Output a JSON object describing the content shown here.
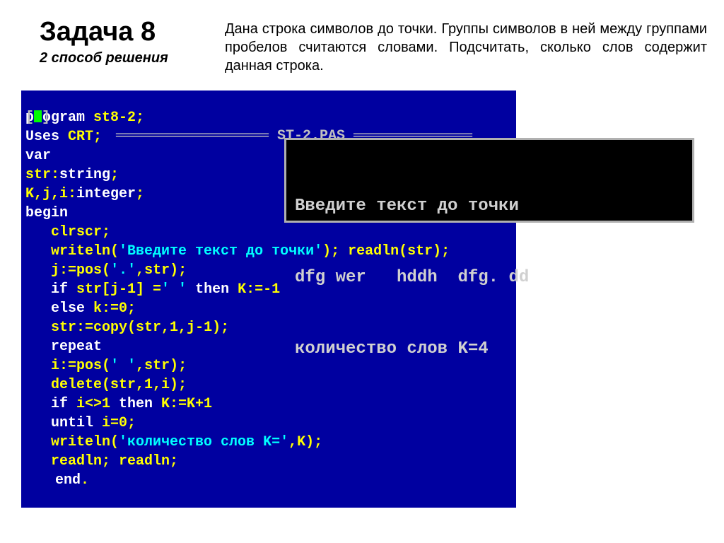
{
  "header": {
    "title": "Задача 8",
    "subtitle": "2 способ решения",
    "problem": "Дана строка символов до точки. Группы символов в ней между группами пробелов считаются словами. Подсчитать, сколько слов содержит данная строка."
  },
  "editor": {
    "filename": "ST-2.PAS",
    "code": {
      "l1_kw": "program ",
      "l1_id": "st8-2",
      "l1_end": ";",
      "l2_kw": "Uses ",
      "l2_id": "CRT",
      "l2_end": ";",
      "l3_kw": "var",
      "l4_id": "str",
      "l4_colon": ":",
      "l4_type": "string",
      "l4_end": ";",
      "l5_id": "K,j,i",
      "l5_colon": ":",
      "l5_type": "integer",
      "l5_end": ";",
      "l6_kw": "begin",
      "l7_id": "clrscr",
      "l7_end": ";",
      "l8a": "writeln",
      "l8b": "(",
      "l8s": "'Введите текст до точки'",
      "l8c": "); ",
      "l8d": "readln",
      "l8e": "(str);",
      "l9a": "j",
      "l9b": ":=",
      "l9c": "pos",
      "l9d": "(",
      "l9s": "'.'",
      "l9e": ",str);",
      "l10a": "if ",
      "l10b": "str[j-1] =",
      "l10s": "' '",
      "l10c": " then ",
      "l10d": "K:=-1",
      "l11a": "else ",
      "l11b": "k:=0;",
      "l12a": "str",
      "l12b": ":=",
      "l12c": "copy",
      "l12d": "(str,1,j-1);",
      "l13": "repeat",
      "l14a": "i",
      "l14b": ":=",
      "l14c": "pos",
      "l14d": "(",
      "l14s": "' '",
      "l14e": ",str);",
      "l15a": "delete",
      "l15b": "(str,1,i);",
      "l16a": "if ",
      "l16b": "i<>1 ",
      "l16c": "then ",
      "l16d": "K:=K+1",
      "l17a": "until ",
      "l17b": "i=0;",
      "l18a": "writeln",
      "l18b": "(",
      "l18s": "'количество слов K='",
      "l18c": ",K);",
      "l19a": "readln",
      "l19b": "; ",
      "l19c": "readln",
      "l19d": ";",
      "l20a": "end",
      "l20b": "."
    }
  },
  "console": {
    "line1": "Введите текст до точки",
    "line2": "dfg wer   hddh  dfg. dd",
    "line3": "количество слов K=4"
  }
}
